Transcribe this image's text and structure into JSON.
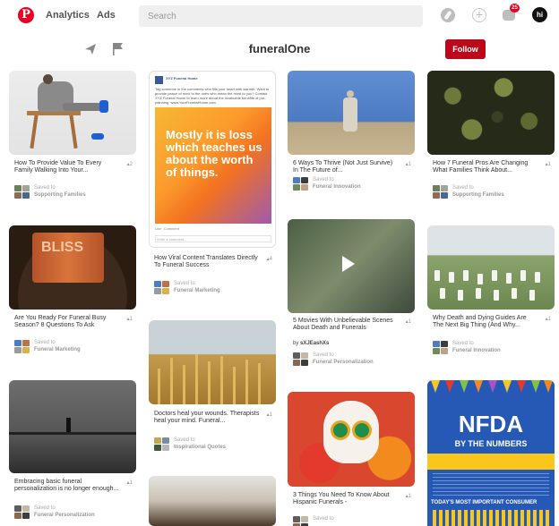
{
  "nav": {
    "logo": "P",
    "analytics": "Analytics",
    "ads": "Ads",
    "search_placeholder": "Search",
    "notification_count": "25",
    "avatar_initials": "hi"
  },
  "board": {
    "title": "funeralOne",
    "follow_label": "Follow"
  },
  "pins": [
    {
      "desc": "How To Provide Value To Every Family Walking Into Your...",
      "count": "2",
      "saved_label": "Saved to",
      "board": "Supporting Families"
    },
    {
      "card_head": "XYZ Funeral Home",
      "card_text": "Tag someone in the comments who fills your heart with warmth. Want to provide peace of mind to the ones who mean the most to you? Contact XYZ Funeral Home to learn more about the invaluable benefits of pre-planning. www.YourFuneralHome.com",
      "quote": "Mostly it is loss which teaches us about the worth of things.",
      "like": "Like",
      "comment": "Comment",
      "write": "Write a comment...",
      "desc": "How Viral Content Translates Directly To Funeral Success",
      "count": "4",
      "saved_label": "Saved to",
      "board": "Funeral Marketing"
    },
    {
      "desc": "6 Ways To Thrive (Not Just Survive) In The Future of...",
      "count": "1",
      "saved_label": "Saved to",
      "board": "Funeral Innovation"
    },
    {
      "desc": "How 7 Funeral Pros Are Changing What Families Think About...",
      "count": "1",
      "saved_label": "Saved to",
      "board": "Supporting Families"
    },
    {
      "can_text": "BLISS",
      "desc": "Are You Ready For Funeral Busy Season? 8 Questions To Ask",
      "count": "1",
      "saved_label": "Saved to",
      "board": "Funeral Marketing"
    },
    {
      "desc": "5 Movies With Unbelievable Scenes About Death and Funerals",
      "count": "1",
      "by_label": "by",
      "by_user": "sXJEashXs",
      "saved_label": "Saved to",
      "board": "Funeral Personalization"
    },
    {
      "desc": "Why Death and Dying Guides Are The Next Big Thing (And Why...",
      "count": "1",
      "saved_label": "Saved to",
      "board": "Funeral Innovation"
    },
    {
      "desc": "Doctors heal your wounds. Therapists heal your mind. Funeral...",
      "count": "1",
      "saved_label": "Saved to",
      "board": "Inspirational Quotes"
    },
    {
      "desc": "Embracing basic funeral personalization is no longer enough...",
      "count": "1",
      "saved_label": "Saved to",
      "board": "Funeral Personalization"
    },
    {
      "desc": "3 Things You Need To Know About Hispanic Funerals -",
      "count": "1",
      "saved_label": "Saved to"
    },
    {
      "headline": "NFDA",
      "subhead": "BY THE NUMBERS",
      "caption": "TODAY'S MOST IMPORTANT CONSUMER"
    }
  ],
  "colors": {
    "brand_red": "#e60023",
    "follow_red": "#bd081c"
  }
}
